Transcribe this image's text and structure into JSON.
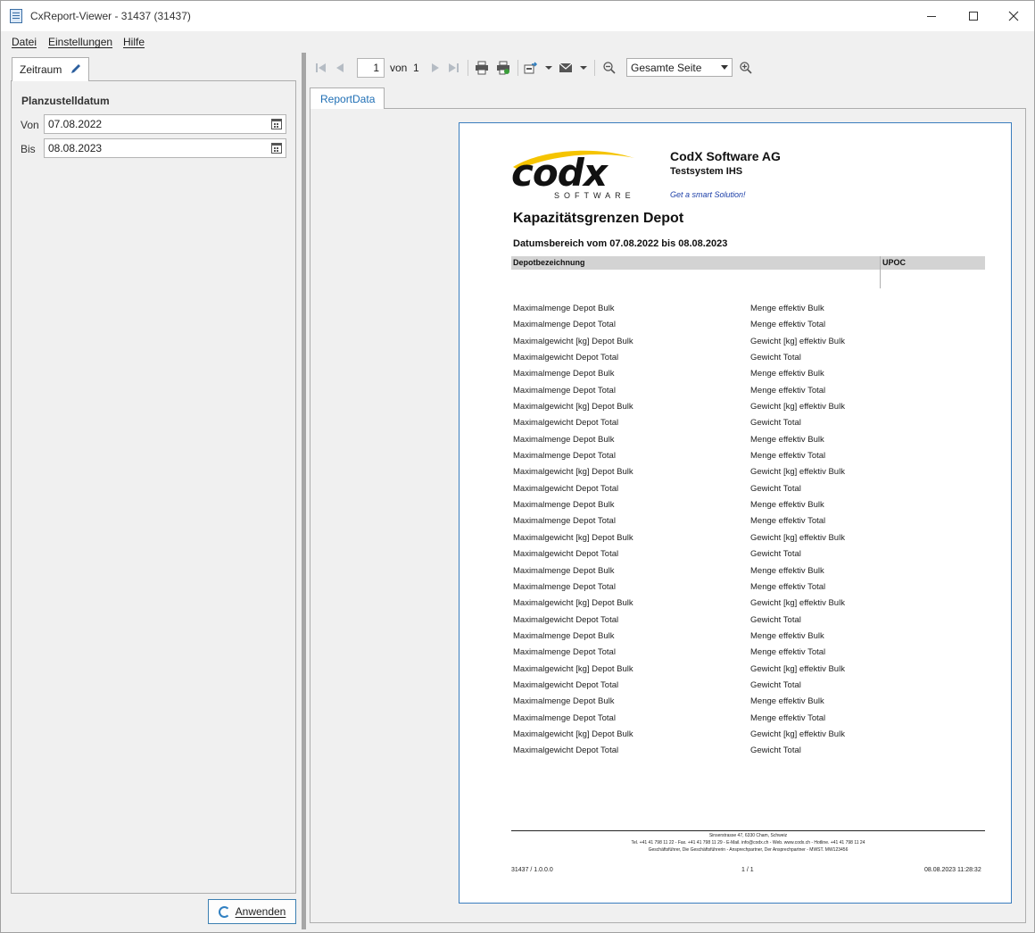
{
  "window": {
    "title": "CxReport-Viewer - 31437 (31437)"
  },
  "menu": {
    "items": [
      "Datei",
      "Einstellungen",
      "Hilfe"
    ]
  },
  "left": {
    "tab_label": "Zeitraum",
    "group_title": "Planzustelldatum",
    "from_label": "Von",
    "from_value": "07.08.2022",
    "to_label": "Bis",
    "to_value": "08.08.2023",
    "apply_label": "Anwenden"
  },
  "toolbar": {
    "page_value": "1",
    "of_label": "von",
    "total_pages": "1",
    "zoom_value": "Gesamte Seite"
  },
  "report": {
    "tab_label": "ReportData",
    "logo_word": "codx",
    "logo_sub": "SOFTWARE",
    "company": "CodX Software AG",
    "system": "Testsystem IHS",
    "slogan": "Get a smart Solution!",
    "title": "Kapazitätsgrenzen Depot",
    "date_range": "Datumsbereich vom 07.08.2022 bis 08.08.2023",
    "col1": "Depotbezeichnung",
    "col2": "UPOC",
    "rows": [
      [
        "Maximalmenge Depot Bulk",
        "Menge effektiv Bulk"
      ],
      [
        "Maximalmenge Depot Total",
        "Menge effektiv Total"
      ],
      [
        "Maximalgewicht [kg] Depot Bulk",
        "Gewicht [kg] effektiv Bulk"
      ],
      [
        "Maximalgewicht Depot Total",
        "Gewicht Total"
      ],
      [
        "Maximalmenge Depot Bulk",
        "Menge effektiv Bulk"
      ],
      [
        "Maximalmenge Depot Total",
        "Menge effektiv Total"
      ],
      [
        "Maximalgewicht [kg] Depot Bulk",
        "Gewicht [kg] effektiv Bulk"
      ],
      [
        "Maximalgewicht Depot Total",
        "Gewicht Total"
      ],
      [
        "Maximalmenge Depot Bulk",
        "Menge effektiv Bulk"
      ],
      [
        "Maximalmenge Depot Total",
        "Menge effektiv Total"
      ],
      [
        "Maximalgewicht [kg] Depot Bulk",
        "Gewicht [kg] effektiv Bulk"
      ],
      [
        "Maximalgewicht Depot Total",
        "Gewicht Total"
      ],
      [
        "Maximalmenge Depot Bulk",
        "Menge effektiv Bulk"
      ],
      [
        "Maximalmenge Depot Total",
        "Menge effektiv Total"
      ],
      [
        "Maximalgewicht [kg] Depot Bulk",
        "Gewicht [kg] effektiv Bulk"
      ],
      [
        "Maximalgewicht Depot Total",
        "Gewicht Total"
      ],
      [
        "Maximalmenge Depot Bulk",
        "Menge effektiv Bulk"
      ],
      [
        "Maximalmenge Depot Total",
        "Menge effektiv Total"
      ],
      [
        "Maximalgewicht [kg] Depot Bulk",
        "Gewicht [kg] effektiv Bulk"
      ],
      [
        "Maximalgewicht Depot Total",
        "Gewicht Total"
      ],
      [
        "Maximalmenge Depot Bulk",
        "Menge effektiv Bulk"
      ],
      [
        "Maximalmenge Depot Total",
        "Menge effektiv Total"
      ],
      [
        "Maximalgewicht [kg] Depot Bulk",
        "Gewicht [kg] effektiv Bulk"
      ],
      [
        "Maximalgewicht Depot Total",
        "Gewicht Total"
      ],
      [
        "Maximalmenge Depot Bulk",
        "Menge effektiv Bulk"
      ],
      [
        "Maximalmenge Depot Total",
        "Menge effektiv Total"
      ],
      [
        "Maximalgewicht [kg] Depot Bulk",
        "Gewicht [kg] effektiv Bulk"
      ],
      [
        "Maximalgewicht Depot Total",
        "Gewicht Total"
      ]
    ],
    "footer_address": "Sinserstrasse 47, 6330 Cham, Schweiz",
    "footer_contact": "Tel. +41 41 798 11 22 - Fax. +41 41 798 11 29 - E-Mail. info@codx.ch - Web. www.codx.ch - Hotline. +41 41 798 11 24",
    "footer_people": "Geschäftsführer, Die Geschäftsführerin - Ansprechpartner, Der Ansprechpartner - MWST. MW123456",
    "footer_left": "31437 / 1.0.0.0",
    "footer_center": "1 / 1",
    "footer_right": "08.08.2023 11:28:32"
  },
  "colors": {
    "accent": "#1f6fb5",
    "page_border": "#3a7dbe",
    "logo_swoosh": "#f5c400"
  },
  "icons": [
    "first-page-icon",
    "prev-page-icon",
    "next-page-icon",
    "last-page-icon",
    "print-icon",
    "print-preview-icon",
    "export-icon",
    "mail-icon",
    "zoom-out-icon",
    "zoom-in-icon"
  ]
}
